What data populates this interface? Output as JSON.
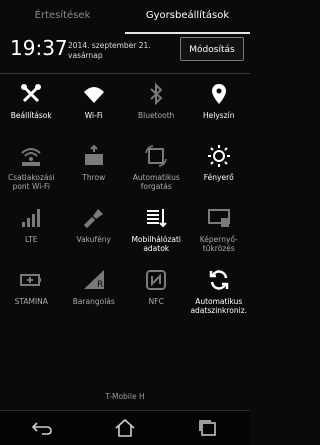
{
  "tabs": {
    "notifications": "Értesítések",
    "quick_settings": "Gyorsbeállítások"
  },
  "header": {
    "time": "19:37",
    "date_line1": "2014. szeptember 21.",
    "date_line2": "vasárnap",
    "edit_label": "Módosítás"
  },
  "tiles": [
    {
      "label": "Beállítások",
      "icon": "settings-icon",
      "on": true
    },
    {
      "label": "Wi-Fi",
      "icon": "wifi-icon",
      "on": true
    },
    {
      "label": "Bluetooth",
      "icon": "bluetooth-icon",
      "on": false
    },
    {
      "label": "Helyszín",
      "icon": "location-icon",
      "on": true
    },
    {
      "label": "Csatlakozási pont Wi-Fi",
      "icon": "hotspot-icon",
      "on": false
    },
    {
      "label": "Throw",
      "icon": "throw-icon",
      "on": false
    },
    {
      "label": "Automatikus forgatás",
      "icon": "rotation-icon",
      "on": false
    },
    {
      "label": "Fényerő",
      "icon": "brightness-icon",
      "on": true
    },
    {
      "label": "LTE",
      "icon": "lte-icon",
      "on": false
    },
    {
      "label": "Vakufény",
      "icon": "flashlight-icon",
      "on": false
    },
    {
      "label": "Mobilhálózati adatok",
      "icon": "mobile-data-icon",
      "on": true
    },
    {
      "label": "Képernyő-tükrözés",
      "icon": "screen-mirror-icon",
      "on": false
    },
    {
      "label": "STAMINA",
      "icon": "stamina-icon",
      "on": false
    },
    {
      "label": "Barangolás",
      "icon": "roaming-icon",
      "on": false
    },
    {
      "label": "NFC",
      "icon": "nfc-icon",
      "on": false
    },
    {
      "label": "Automatikus adatszinkroniz.",
      "icon": "sync-icon",
      "on": true
    }
  ],
  "footer": {
    "carrier": "T-Mobile H"
  },
  "colors": {
    "on": "#ffffff",
    "off": "#7a7a7a",
    "background": "#0a0a0a"
  }
}
